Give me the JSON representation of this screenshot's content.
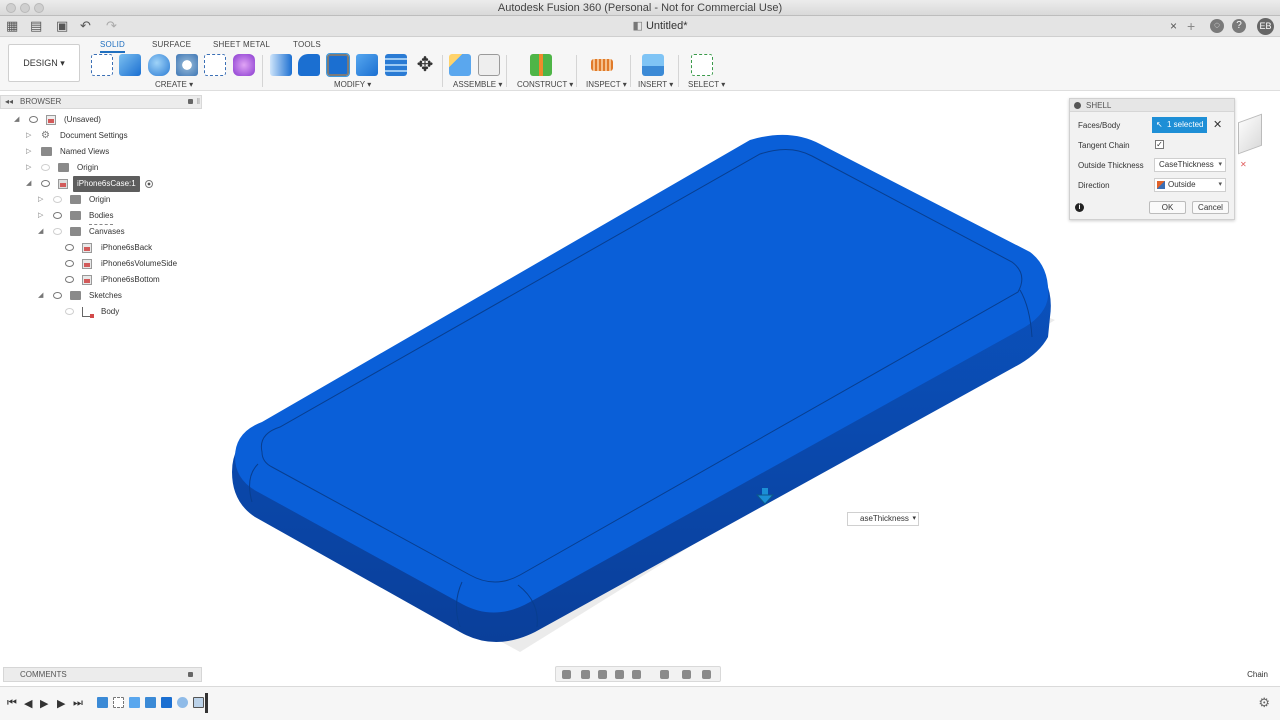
{
  "window": {
    "title": "Autodesk Fusion 360 (Personal - Not for Commercial Use)"
  },
  "tabbar": {
    "document_title": "Untitled*",
    "close_symbol": "×",
    "plus_symbol": "+",
    "user_initials": "EB",
    "help_symbol": "?"
  },
  "toolbar": {
    "workspace": "DESIGN ▾",
    "tabs": [
      "SOLID",
      "SURFACE",
      "SHEET METAL",
      "TOOLS"
    ],
    "groups": {
      "create": "CREATE ▾",
      "modify": "MODIFY ▾",
      "assemble": "ASSEMBLE ▾",
      "construct": "CONSTRUCT ▾",
      "inspect": "INSPECT ▾",
      "insert": "INSERT ▾",
      "select": "SELECT ▾"
    }
  },
  "browser": {
    "header": "BROWSER",
    "items": [
      {
        "label": "(Unsaved)"
      },
      {
        "label": "Document Settings"
      },
      {
        "label": "Named Views"
      },
      {
        "label": "Origin"
      },
      {
        "label": "iPhone6sCase:1"
      },
      {
        "label": "Origin"
      },
      {
        "label": "Bodies"
      },
      {
        "label": "Canvases"
      },
      {
        "label": "iPhone6sBack"
      },
      {
        "label": "iPhone6sVolumeSide"
      },
      {
        "label": "iPhone6sBottom"
      },
      {
        "label": "Sketches"
      },
      {
        "label": "Body"
      }
    ]
  },
  "shell": {
    "title": "SHELL",
    "faces_label": "Faces/Body",
    "faces_value": "1 selected",
    "tangent_label": "Tangent Chain",
    "tangent_checked": true,
    "thickness_label": "Outside Thickness",
    "thickness_value": "CaseThickness",
    "direction_label": "Direction",
    "direction_value": "Outside",
    "ok": "OK",
    "cancel": "Cancel"
  },
  "viewport": {
    "thickness_input": "aseThickness",
    "body_color": "#0a5fd8"
  },
  "comments": {
    "header": "COMMENTS"
  },
  "status": {
    "chain": "Chain"
  }
}
